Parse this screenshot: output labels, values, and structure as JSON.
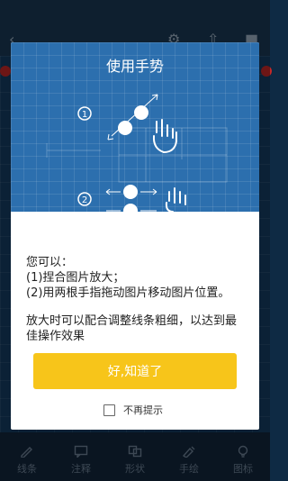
{
  "tutorial": {
    "title": "使用手势",
    "steps": [
      "1",
      "2"
    ],
    "intro": "您可以：",
    "items": [
      "(1)捏合图片放大；",
      "(2)用两根手指拖动图片移动图片位置。"
    ],
    "note": "放大时可以配合调整线条粗细，以达到最佳操作效果",
    "confirm_label": "好,知道了",
    "dont_show_label": "不再提示",
    "dont_show_checked": false
  },
  "toolbar": {
    "tools": [
      {
        "label": "线条",
        "icon": "pencil-icon"
      },
      {
        "label": "注释",
        "icon": "comment-icon"
      },
      {
        "label": "形状",
        "icon": "shapes-icon"
      },
      {
        "label": "手绘",
        "icon": "freehand-icon"
      },
      {
        "label": "图标",
        "icon": "lightbulb-icon"
      }
    ]
  },
  "colors": {
    "accent": "#f7c51a",
    "illustration_bg": "#2c6fae"
  }
}
